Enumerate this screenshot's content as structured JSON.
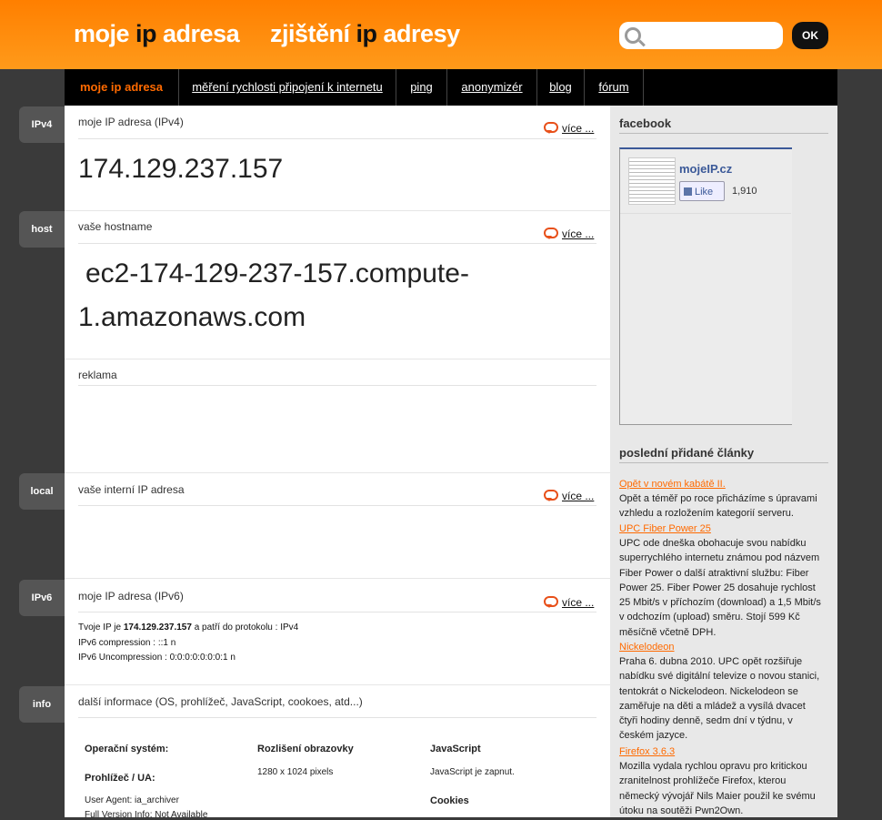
{
  "header": {
    "logo_left": {
      "pre": "moje ",
      "ip": "ip",
      "post": " adresa"
    },
    "logo_right": {
      "pre": "zjištění ",
      "ip": "ip",
      "post": " adresy"
    },
    "search_value": "",
    "ok_label": "OK"
  },
  "nav": [
    {
      "label": "moje ip adresa",
      "active": true
    },
    {
      "label": "měření rychlosti připojení k internetu"
    },
    {
      "label": "ping"
    },
    {
      "label": "anonymizér"
    },
    {
      "label": "blog"
    },
    {
      "label": "fórum"
    }
  ],
  "sections": {
    "ipv4": {
      "tab": "IPv4",
      "title": "moje IP adresa (IPv4)",
      "more": "více ...",
      "value": "174.129.237.157"
    },
    "host": {
      "tab": "host",
      "title": "vaše hostname",
      "more": "více ...",
      "line1": "ec2-174-129-237-157.compute-",
      "line2": "1.amazonaws.com"
    },
    "ad": {
      "title": "reklama"
    },
    "local": {
      "tab": "local",
      "title": "vaše interní IP adresa",
      "more": "více ..."
    },
    "ipv6": {
      "tab": "IPv6",
      "title": "moje IP adresa (IPv6)",
      "more": "více ...",
      "line1_pre": "Tvoje IP je ",
      "line1_ip": "174.129.237.157",
      "line1_post": " a patří do protokolu : IPv4",
      "line2": "IPv6 compression : ::1 n",
      "line3": "IPv6 Uncompression : 0:0:0:0:0:0:0:1 n"
    },
    "info": {
      "tab": "info",
      "title": "další informace (OS, prohlížeč, JavaScript, cookoes, atd...)",
      "os_label": "Operační systém:",
      "browser_label": "Prohlížeč / UA:",
      "user_agent": "User Agent: ia_archiver",
      "full_version": "Full Version Info: Not Available",
      "resolution_label": "Rozlišení obrazovky",
      "resolution_value": "1280 x 1024 pixels",
      "js_label": "JavaScript",
      "js_value": "JavaScript je zapnut.",
      "cookies_label": "Cookies"
    }
  },
  "sidebar": {
    "facebook_title": "facebook",
    "fb_page": "mojeIP.cz",
    "fb_like": "Like",
    "fb_count": "1,910",
    "articles_title": "poslední přidané články",
    "articles": [
      {
        "title": "Opět v novém kabátě II.",
        "text": "Opět a téměř po roce přicházíme s úpravami vzhledu a rozložením kategorií serveru."
      },
      {
        "title": "UPC Fiber Power 25",
        "text": "UPC ode dneška obohacuje svou nabídku superrychlého internetu známou pod názvem Fiber Power o další atraktivní službu: Fiber Power 25. Fiber Power 25 dosahuje rychlost 25 Mbit/s v příchozím (download) a 1,5 Mbit/s v odchozím (upload) směru. Stojí 599 Kč měsíčně včetně DPH."
      },
      {
        "title": "Nickelodeon",
        "text": "Praha 6. dubna 2010. UPC opět rozšiřuje nabídku své digitální televize o novou stanici, tentokrát o Nickelodeon. Nickelodeon se zaměřuje na děti a mládež a vysílá dvacet čtyři hodiny denně, sedm dní v týdnu, v českém jazyce."
      },
      {
        "title": "Firefox 3.6.3",
        "text": "Mozilla vydala rychlou opravu pro kritickou zranitelnost prohlížeče Firefox, kterou německý vývojář Nils Maier použil ke svému útoku na soutěži Pwn2Own."
      }
    ]
  }
}
